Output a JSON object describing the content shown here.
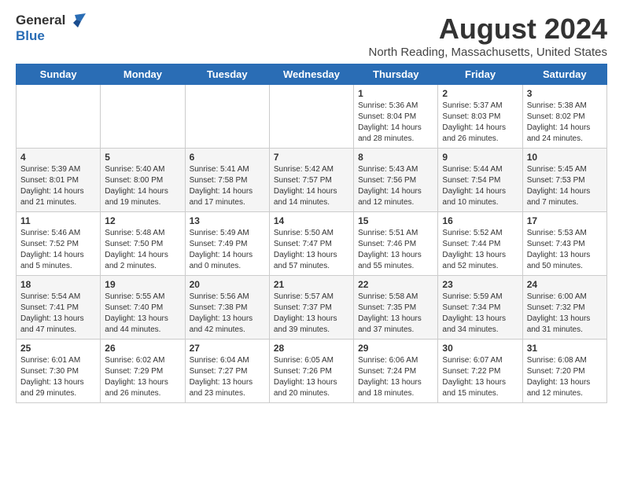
{
  "logo": {
    "general": "General",
    "blue": "Blue"
  },
  "title": "August 2024",
  "subtitle": "North Reading, Massachusetts, United States",
  "headers": [
    "Sunday",
    "Monday",
    "Tuesday",
    "Wednesday",
    "Thursday",
    "Friday",
    "Saturday"
  ],
  "weeks": [
    [
      {
        "day": "",
        "info": ""
      },
      {
        "day": "",
        "info": ""
      },
      {
        "day": "",
        "info": ""
      },
      {
        "day": "",
        "info": ""
      },
      {
        "day": "1",
        "info": "Sunrise: 5:36 AM\nSunset: 8:04 PM\nDaylight: 14 hours\nand 28 minutes."
      },
      {
        "day": "2",
        "info": "Sunrise: 5:37 AM\nSunset: 8:03 PM\nDaylight: 14 hours\nand 26 minutes."
      },
      {
        "day": "3",
        "info": "Sunrise: 5:38 AM\nSunset: 8:02 PM\nDaylight: 14 hours\nand 24 minutes."
      }
    ],
    [
      {
        "day": "4",
        "info": "Sunrise: 5:39 AM\nSunset: 8:01 PM\nDaylight: 14 hours\nand 21 minutes."
      },
      {
        "day": "5",
        "info": "Sunrise: 5:40 AM\nSunset: 8:00 PM\nDaylight: 14 hours\nand 19 minutes."
      },
      {
        "day": "6",
        "info": "Sunrise: 5:41 AM\nSunset: 7:58 PM\nDaylight: 14 hours\nand 17 minutes."
      },
      {
        "day": "7",
        "info": "Sunrise: 5:42 AM\nSunset: 7:57 PM\nDaylight: 14 hours\nand 14 minutes."
      },
      {
        "day": "8",
        "info": "Sunrise: 5:43 AM\nSunset: 7:56 PM\nDaylight: 14 hours\nand 12 minutes."
      },
      {
        "day": "9",
        "info": "Sunrise: 5:44 AM\nSunset: 7:54 PM\nDaylight: 14 hours\nand 10 minutes."
      },
      {
        "day": "10",
        "info": "Sunrise: 5:45 AM\nSunset: 7:53 PM\nDaylight: 14 hours\nand 7 minutes."
      }
    ],
    [
      {
        "day": "11",
        "info": "Sunrise: 5:46 AM\nSunset: 7:52 PM\nDaylight: 14 hours\nand 5 minutes."
      },
      {
        "day": "12",
        "info": "Sunrise: 5:48 AM\nSunset: 7:50 PM\nDaylight: 14 hours\nand 2 minutes."
      },
      {
        "day": "13",
        "info": "Sunrise: 5:49 AM\nSunset: 7:49 PM\nDaylight: 14 hours\nand 0 minutes."
      },
      {
        "day": "14",
        "info": "Sunrise: 5:50 AM\nSunset: 7:47 PM\nDaylight: 13 hours\nand 57 minutes."
      },
      {
        "day": "15",
        "info": "Sunrise: 5:51 AM\nSunset: 7:46 PM\nDaylight: 13 hours\nand 55 minutes."
      },
      {
        "day": "16",
        "info": "Sunrise: 5:52 AM\nSunset: 7:44 PM\nDaylight: 13 hours\nand 52 minutes."
      },
      {
        "day": "17",
        "info": "Sunrise: 5:53 AM\nSunset: 7:43 PM\nDaylight: 13 hours\nand 50 minutes."
      }
    ],
    [
      {
        "day": "18",
        "info": "Sunrise: 5:54 AM\nSunset: 7:41 PM\nDaylight: 13 hours\nand 47 minutes."
      },
      {
        "day": "19",
        "info": "Sunrise: 5:55 AM\nSunset: 7:40 PM\nDaylight: 13 hours\nand 44 minutes."
      },
      {
        "day": "20",
        "info": "Sunrise: 5:56 AM\nSunset: 7:38 PM\nDaylight: 13 hours\nand 42 minutes."
      },
      {
        "day": "21",
        "info": "Sunrise: 5:57 AM\nSunset: 7:37 PM\nDaylight: 13 hours\nand 39 minutes."
      },
      {
        "day": "22",
        "info": "Sunrise: 5:58 AM\nSunset: 7:35 PM\nDaylight: 13 hours\nand 37 minutes."
      },
      {
        "day": "23",
        "info": "Sunrise: 5:59 AM\nSunset: 7:34 PM\nDaylight: 13 hours\nand 34 minutes."
      },
      {
        "day": "24",
        "info": "Sunrise: 6:00 AM\nSunset: 7:32 PM\nDaylight: 13 hours\nand 31 minutes."
      }
    ],
    [
      {
        "day": "25",
        "info": "Sunrise: 6:01 AM\nSunset: 7:30 PM\nDaylight: 13 hours\nand 29 minutes."
      },
      {
        "day": "26",
        "info": "Sunrise: 6:02 AM\nSunset: 7:29 PM\nDaylight: 13 hours\nand 26 minutes."
      },
      {
        "day": "27",
        "info": "Sunrise: 6:04 AM\nSunset: 7:27 PM\nDaylight: 13 hours\nand 23 minutes."
      },
      {
        "day": "28",
        "info": "Sunrise: 6:05 AM\nSunset: 7:26 PM\nDaylight: 13 hours\nand 20 minutes."
      },
      {
        "day": "29",
        "info": "Sunrise: 6:06 AM\nSunset: 7:24 PM\nDaylight: 13 hours\nand 18 minutes."
      },
      {
        "day": "30",
        "info": "Sunrise: 6:07 AM\nSunset: 7:22 PM\nDaylight: 13 hours\nand 15 minutes."
      },
      {
        "day": "31",
        "info": "Sunrise: 6:08 AM\nSunset: 7:20 PM\nDaylight: 13 hours\nand 12 minutes."
      }
    ]
  ]
}
